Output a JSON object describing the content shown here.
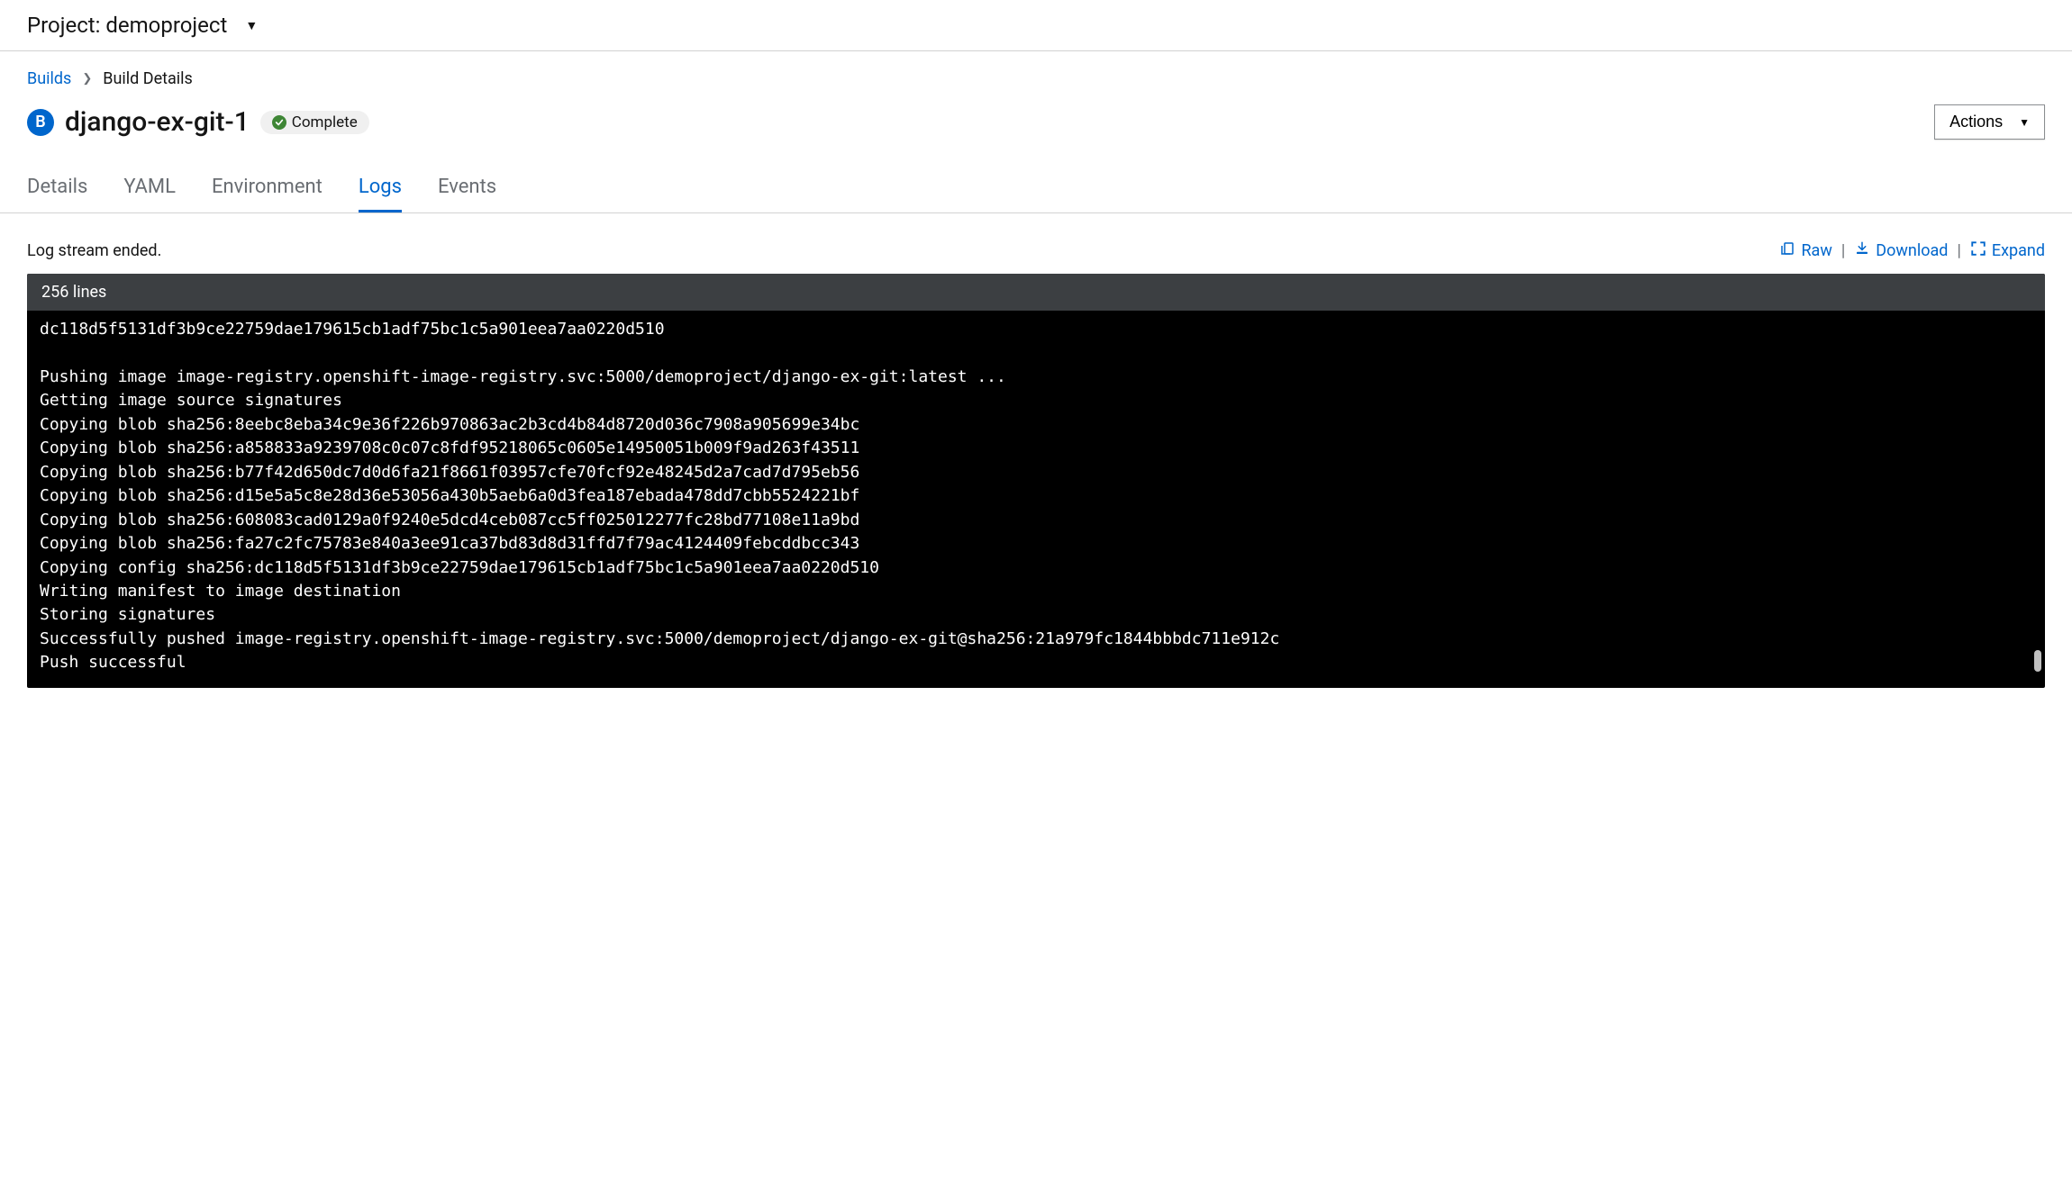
{
  "project_bar": {
    "label": "Project: demoproject"
  },
  "breadcrumb": {
    "root": "Builds",
    "current": "Build Details"
  },
  "title": {
    "badge_letter": "B",
    "name": "django-ex-git-1",
    "status": "Complete"
  },
  "actions_label": "Actions",
  "tabs": [
    "Details",
    "YAML",
    "Environment",
    "Logs",
    "Events"
  ],
  "active_tab": "Logs",
  "log_status": "Log stream ended.",
  "log_actions": {
    "raw": "Raw",
    "download": "Download",
    "expand": "Expand"
  },
  "log_count": "256 lines",
  "log_lines": [
    "dc118d5f5131df3b9ce22759dae179615cb1adf75bc1c5a901eea7aa0220d510",
    "",
    "Pushing image image-registry.openshift-image-registry.svc:5000/demoproject/django-ex-git:latest ...",
    "Getting image source signatures",
    "Copying blob sha256:8eebc8eba34c9e36f226b970863ac2b3cd4b84d8720d036c7908a905699e34bc",
    "Copying blob sha256:a858833a9239708c0c07c8fdf95218065c0605e14950051b009f9ad263f43511",
    "Copying blob sha256:b77f42d650dc7d0d6fa21f8661f03957cfe70fcf92e48245d2a7cad7d795eb56",
    "Copying blob sha256:d15e5a5c8e28d36e53056a430b5aeb6a0d3fea187ebada478dd7cbb5524221bf",
    "Copying blob sha256:608083cad0129a0f9240e5dcd4ceb087cc5ff025012277fc28bd77108e11a9bd",
    "Copying blob sha256:fa27c2fc75783e840a3ee91ca37bd83d8d31ffd7f79ac4124409febcddbcc343",
    "Copying config sha256:dc118d5f5131df3b9ce22759dae179615cb1adf75bc1c5a901eea7aa0220d510",
    "Writing manifest to image destination",
    "Storing signatures",
    "Successfully pushed image-registry.openshift-image-registry.svc:5000/demoproject/django-ex-git@sha256:21a979fc1844bbbdc711e912c",
    "Push successful"
  ]
}
